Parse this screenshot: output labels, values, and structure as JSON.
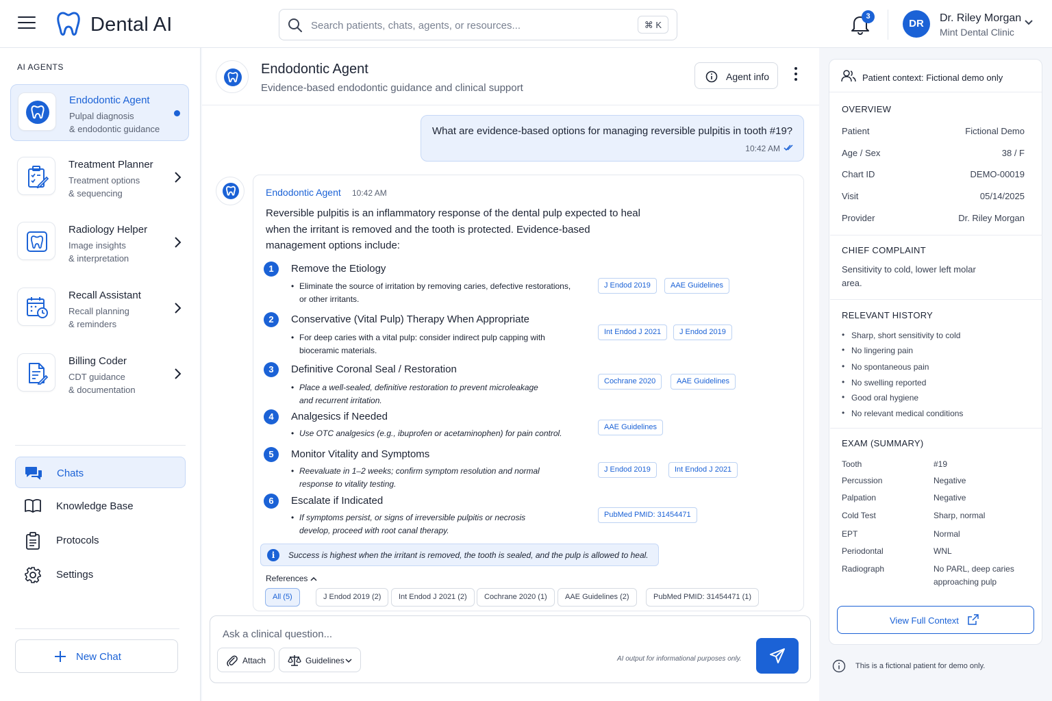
{
  "header": {
    "brand": "Dental AI",
    "search_placeholder": "Search patients, chats, agents, or resources...",
    "search_shortcut": "⌘ K",
    "notification_count": "3",
    "user": {
      "initials": "DR",
      "name": "Dr. Riley Morgan",
      "clinic": "Mint Dental Clinic"
    }
  },
  "sidebar": {
    "section_label": "AI AGENTS",
    "agents": [
      {
        "title": "Endodontic Agent",
        "line1": "Pulpal diagnosis",
        "line2": "& endodontic guidance",
        "active": true
      },
      {
        "title": "Treatment Planner",
        "line1": "Treatment options",
        "line2": "& sequencing"
      },
      {
        "title": "Radiology Helper",
        "line1": "Image insights",
        "line2": "& interpretation"
      },
      {
        "title": "Recall Assistant",
        "line1": "Recall planning",
        "line2": "& reminders"
      },
      {
        "title": "Billing Coder",
        "line1": "CDT guidance",
        "line2": "& documentation"
      }
    ],
    "nav": [
      {
        "label": "Chats",
        "active": true
      },
      {
        "label": "Knowledge Base"
      },
      {
        "label": "Protocols"
      },
      {
        "label": "Settings"
      }
    ],
    "new_chat": "New Chat"
  },
  "chat": {
    "title": "Endodontic Agent",
    "subtitle": "Evidence-based endodontic guidance and clinical support",
    "agent_info": "Agent info",
    "user_message": {
      "text": "What are evidence-based options for managing reversible pulpitis in tooth #19?",
      "time": "10:42 AM"
    },
    "reply": {
      "name": "Endodontic Agent",
      "time": "10:42 AM",
      "intro": "Reversible pulpitis is an inflammatory response of the dental pulp expected to heal when the irritant is removed and the tooth is protected. Evidence-based management options include:",
      "steps": [
        {
          "num": "1",
          "title": "Remove the Etiology",
          "bullet": "Eliminate the source of irritation by removing caries, defective restorations, or other irritants.",
          "refs": [
            "J Endod 2019",
            "AAE Guidelines"
          ]
        },
        {
          "num": "2",
          "title": "Conservative (Vital Pulp) Therapy When Appropriate",
          "bullet": "For deep caries with a vital pulp: consider indirect pulp capping with bioceramic materials.",
          "refs": [
            "Int Endod J 2021",
            "J Endod 2019"
          ]
        },
        {
          "num": "3",
          "title": "Definitive Coronal Seal / Restoration",
          "bullet": "Place a well-sealed, definitive restoration to prevent microleakage and recurrent irritation.",
          "refs": [
            "Cochrane 2020",
            "AAE Guidelines"
          ]
        },
        {
          "num": "4",
          "title": "Analgesics if Needed",
          "bullet": "Use OTC analgesics (e.g., ibuprofen or acetaminophen) for pain control.",
          "refs": [
            "AAE Guidelines"
          ]
        },
        {
          "num": "5",
          "title": "Monitor Vitality and Symptoms",
          "bullet": "Reevaluate in 1–2 weeks; confirm symptom resolution and normal response to vitality testing.",
          "refs": [
            "J Endod 2019",
            "Int Endod J 2021"
          ]
        },
        {
          "num": "6",
          "title": "Escalate if Indicated",
          "bullet": "If symptoms persist, or signs of irreversible pulpitis or necrosis develop, proceed with root canal therapy.",
          "refs": [
            "PubMed PMID: 31454471"
          ]
        }
      ],
      "callout": "Success is highest when the irritant is removed, the tooth is sealed, and the pulp is allowed to heal.",
      "references_label": "References",
      "reference_chips": [
        "All (5)",
        "J Endod 2019 (2)",
        "Int Endod J 2021 (2)",
        "Cochrane 2020 (1)",
        "AAE Guidelines (2)",
        "PubMed PMID: 31454471 (1)"
      ]
    },
    "composer": {
      "placeholder": "Ask a clinical question...",
      "attach": "Attach",
      "guidelines": "Guidelines",
      "disclaimer": "AI output for informational purposes only."
    }
  },
  "context": {
    "header": "Patient context: Fictional demo only",
    "overview_label": "OVERVIEW",
    "overview": [
      {
        "k": "Patient",
        "v": "Fictional Demo"
      },
      {
        "k": "Age / Sex",
        "v": "38 / F"
      },
      {
        "k": "Chart ID",
        "v": "DEMO-00019"
      },
      {
        "k": "Visit",
        "v": "05/14/2025"
      },
      {
        "k": "Provider",
        "v": "Dr. Riley Morgan"
      }
    ],
    "chief_label": "CHIEF COMPLAINT",
    "chief": "Sensitivity to cold, lower left molar area.",
    "history_label": "RELEVANT HISTORY",
    "history": [
      "Sharp, short sensitivity to cold",
      "No lingering pain",
      "No spontaneous pain",
      "No swelling reported",
      "Good oral hygiene",
      "No relevant medical conditions"
    ],
    "exam_label": "EXAM (SUMMARY)",
    "exam": [
      {
        "k": "Tooth",
        "v": "#19"
      },
      {
        "k": "Percussion",
        "v": "Negative"
      },
      {
        "k": "Palpation",
        "v": "Negative"
      },
      {
        "k": "Cold Test",
        "v": "Sharp, normal"
      },
      {
        "k": "EPT",
        "v": "Normal"
      },
      {
        "k": "Periodontal",
        "v": "WNL"
      },
      {
        "k": "Radiograph",
        "v": "No PARL, deep caries approaching pulp"
      }
    ],
    "view_full": "View Full Context",
    "footnote": "This is a fictional patient for demo only."
  },
  "colors": {
    "accent": "#1b62d6",
    "accent_soft": "#eaf1fd",
    "border": "#e3e7ee"
  }
}
